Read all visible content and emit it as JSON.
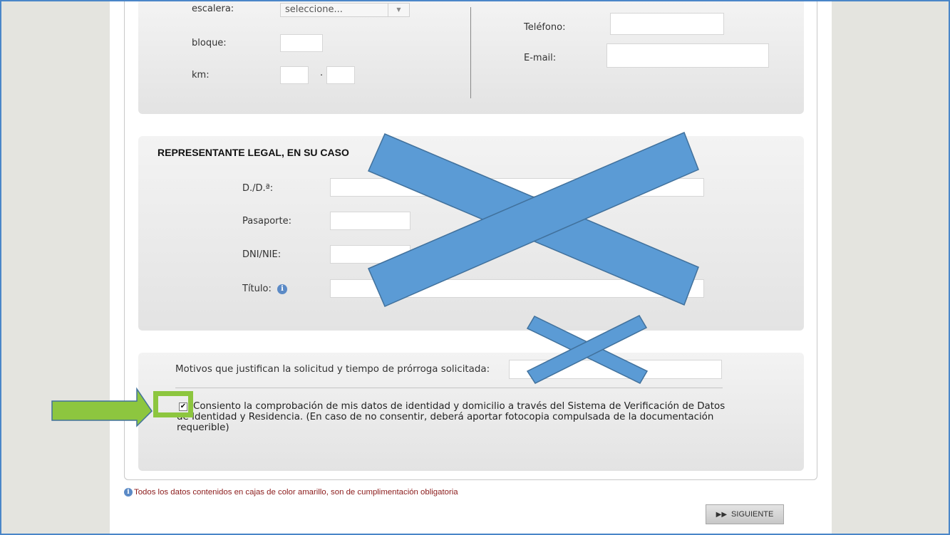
{
  "address": {
    "escalera_label": "escalera:",
    "escalera_value": "seleccione...",
    "bloque_label": "bloque:",
    "km_label": "km:",
    "km_separator": ".",
    "telefono_label": "Teléfono:",
    "email_label": "E-mail:"
  },
  "representante": {
    "title": "REPRESENTANTE LEGAL, EN SU CASO",
    "dd_label": "D./D.ª:",
    "pasaporte_label": "Pasaporte:",
    "dni_label": "DNI/NIE:",
    "titulo_label": "Título:",
    "info_glyph": "i"
  },
  "motivos": {
    "label": "Motivos que justifican la solicitud y tiempo de prórroga solicitada:",
    "consent_checked_glyph": "✔",
    "consent_text": "Consiento la comprobación de mis datos de identidad y domicilio a través del Sistema de Verificación de Datos de Identidad y Residencia. (En caso de no consentir, deberá aportar fotocopia compulsada de la documentación requerible)"
  },
  "footer": {
    "note": "Todos los datos contenidos en cajas de color amarillo, son de cumplimentación obligatoria",
    "next_button": "SIGUIENTE",
    "next_glyph": "▶▶"
  },
  "colors": {
    "annotation_x": "#5b9bd5",
    "annotation_arrow": "#8dc63f",
    "frame": "#4a86c8"
  }
}
